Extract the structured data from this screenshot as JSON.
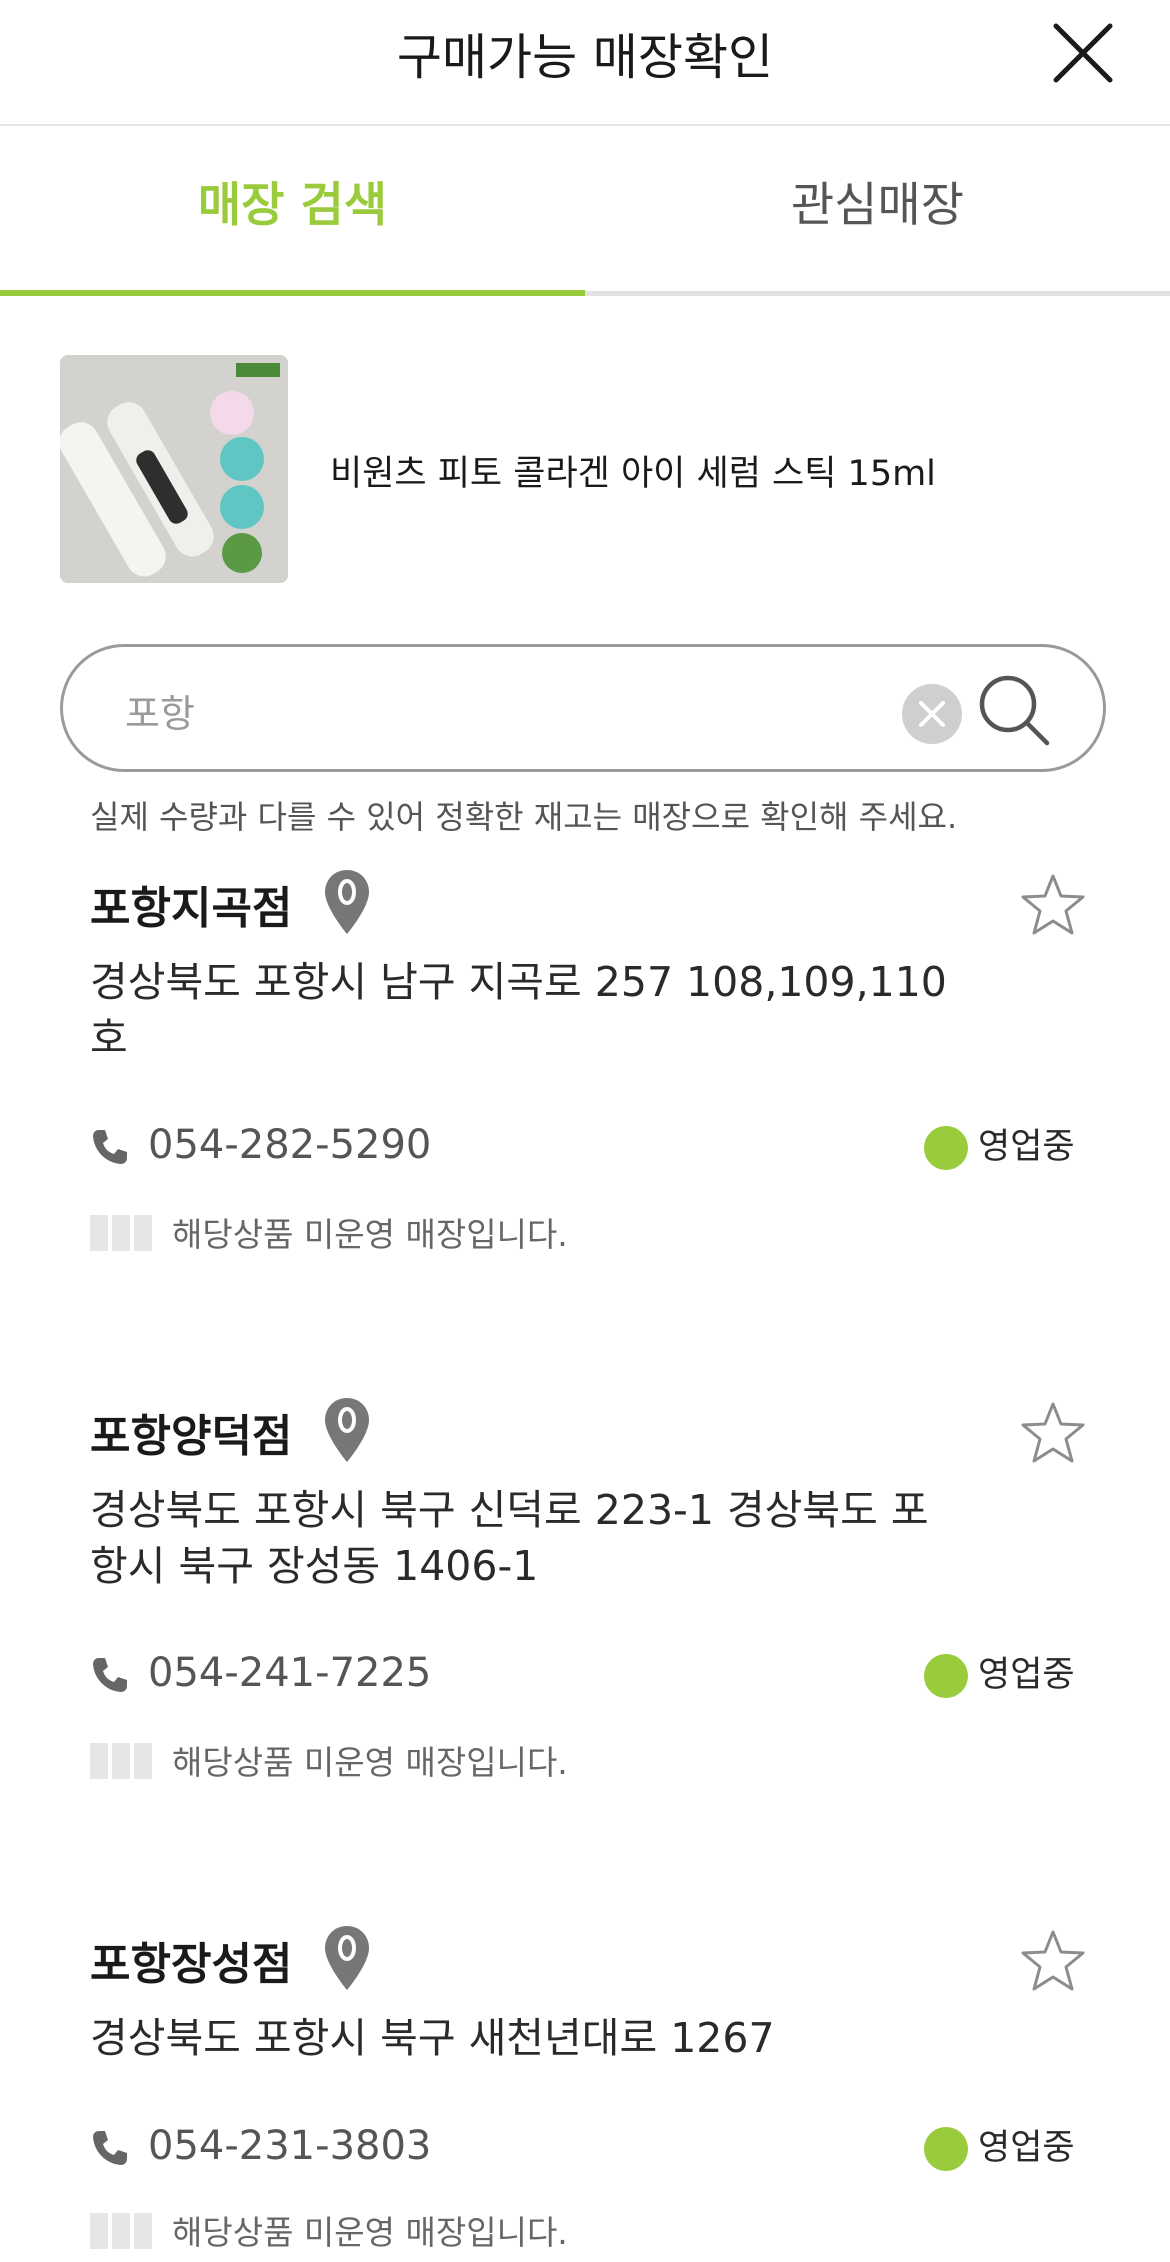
{
  "header": {
    "title": "구매가능 매장확인"
  },
  "tabs": [
    {
      "label": "매장 검색",
      "active": true
    },
    {
      "label": "관심매장",
      "active": false
    }
  ],
  "product": {
    "name": "비원츠 피토 콜라겐 아이 세럼 스틱 15ml"
  },
  "search": {
    "value": "포항"
  },
  "notice": "실제 수량과 다를 수 있어 정확한 재고는 매장으로 확인해 주세요.",
  "stores": [
    {
      "name": "포항지곡점",
      "address": "경상북도 포항시 남구 지곡로 257 108,109,110호",
      "phone": "054-282-5290",
      "status": "영업중",
      "stock_text": "해당상품 미운영 매장입니다."
    },
    {
      "name": "포항양덕점",
      "address": "경상북도 포항시 북구 신덕로 223-1 경상북도 포항시 북구 장성동 1406-1",
      "phone": "054-241-7225",
      "status": "영업중",
      "stock_text": "해당상품 미운영 매장입니다."
    },
    {
      "name": "포항장성점",
      "address": "경상북도 포항시 북구 새천년대로 1267",
      "phone": "054-231-3803",
      "status": "영업중",
      "stock_text": "해당상품 미운영 매장입니다."
    }
  ],
  "colors": {
    "accent": "#9acb3c",
    "status_open": "#9acb3c"
  }
}
